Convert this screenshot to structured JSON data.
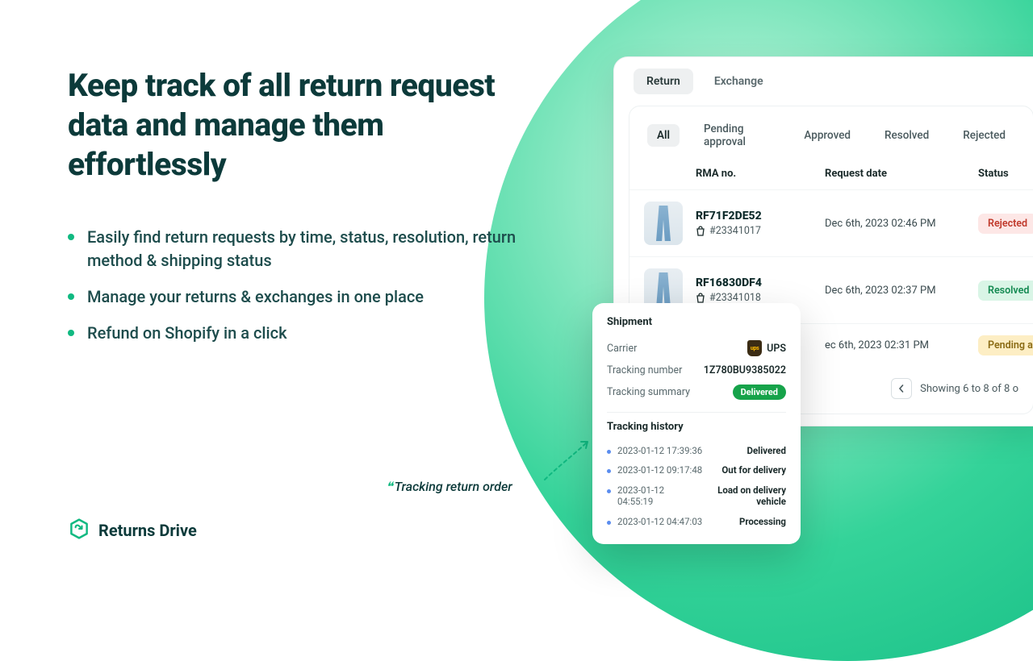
{
  "hero": {
    "headline": "Keep track of all return request data and manage them effortlessly",
    "bullets": [
      "Easily find return requests by time, status, resolution, return method & shipping status",
      "Manage your returns & exchanges in one place",
      "Refund on Shopify in a click"
    ]
  },
  "brand": {
    "name": "Returns Drive"
  },
  "dashboard": {
    "top_tabs": {
      "return": "Return",
      "exchange": "Exchange"
    },
    "filter_tabs": [
      "All",
      "Pending approval",
      "Approved",
      "Resolved",
      "Rejected"
    ],
    "columns": {
      "rma": "RMA no.",
      "date": "Request date",
      "status": "Status"
    },
    "rows": [
      {
        "rma": "RF71F2DE52",
        "order": "#23341017",
        "date": "Dec 6th, 2023 02:46 PM",
        "status_label": "Rejected",
        "status_kind": "rejected"
      },
      {
        "rma": "RF16830DF4",
        "order": "#23341018",
        "date": "Dec 6th, 2023 02:37 PM",
        "status_label": "Resolved",
        "status_kind": "resolved"
      },
      {
        "rma": "",
        "order": "",
        "date": "ec 6th, 2023 02:31 PM",
        "status_label": "Pending approval",
        "status_kind": "pending"
      }
    ],
    "pagination": "Showing 6 to 8 of 8 o"
  },
  "shipment": {
    "title": "Shipment",
    "carrier_label": "Carrier",
    "carrier_name": "UPS",
    "tracking_label": "Tracking number",
    "tracking_number": "1Z780BU9385022",
    "summary_label": "Tracking summary",
    "summary_value": "Delivered",
    "history_label": "Tracking history",
    "history": [
      {
        "time": "2023-01-12 17:39:36",
        "status": "Delivered"
      },
      {
        "time": "2023-01-12 09:17:48",
        "status": "Out for delivery"
      },
      {
        "time": "2023-01-12 04:55:19",
        "status": "Load on delivery vehicle"
      },
      {
        "time": "2023-01-12 04:47:03",
        "status": "Processing"
      }
    ]
  },
  "callout": {
    "label": "Tracking return order"
  }
}
